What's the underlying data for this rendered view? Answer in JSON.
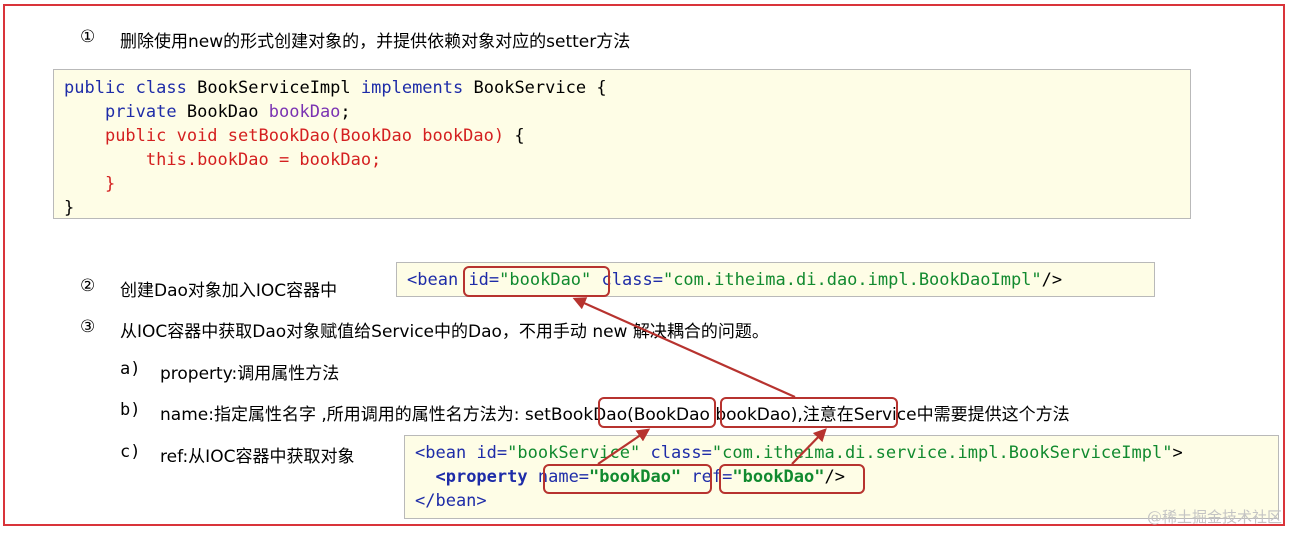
{
  "steps": {
    "s1": {
      "num": "①",
      "text": "删除使用new的形式创建对象的，并提供依赖对象对应的setter方法"
    },
    "s2": {
      "num": "②",
      "text": "创建Dao对象加入IOC容器中"
    },
    "s3": {
      "num": "③",
      "text": "从IOC容器中获取Dao对象赋值给Service中的Dao，不用手动 new 解决耦合的问题。"
    }
  },
  "sub": {
    "a": {
      "label": "a)",
      "text": "property:调用属性方法"
    },
    "b": {
      "label": "b)",
      "pre": "name:指定属性名字 ,所用调用的属性名方法为:",
      "setter": "setBookDao",
      "paren_open": "(",
      "param": "BookDao bookDao",
      "post": "),注意在Service中需要提供这个方法"
    },
    "c": {
      "label": "c)",
      "text": "ref:从IOC容器中获取对象"
    }
  },
  "java": {
    "l1_public": "public",
    "l1_class": "class",
    "l1_name": "BookServiceImpl",
    "l1_impl": "implements",
    "l1_iface": "BookService {",
    "l2_private": "private",
    "l2_type": "BookDao",
    "l2_field": "bookDao",
    "l2_semi": ";",
    "l3": "public void setBookDao(BookDao bookDao)",
    "l3_brace": "{",
    "l4": "this.bookDao = bookDao;",
    "l5": "}",
    "l6": "}"
  },
  "xml1": {
    "open": "<bean",
    "id_attr": "id=",
    "id_val": "\"bookDao\"",
    "class_attr": "class=",
    "class_val": "\"com.itheima.di.dao.impl.BookDaoImpl\"",
    "close": "/>"
  },
  "xml2": {
    "open": "<bean",
    "id_attr": "id=",
    "id_val": "\"bookService\"",
    "class_attr": "class=",
    "class_val": "\"com.itheima.di.service.impl.BookServiceImpl\"",
    "close": ">",
    "prop_open": "<property",
    "name_attr": "name=",
    "name_val": "\"bookDao\"",
    "ref_attr": "ref=",
    "ref_val": "\"bookDao\"",
    "prop_close": "/>",
    "end": "</bean>"
  },
  "watermark": "@稀土掘金技术社区"
}
